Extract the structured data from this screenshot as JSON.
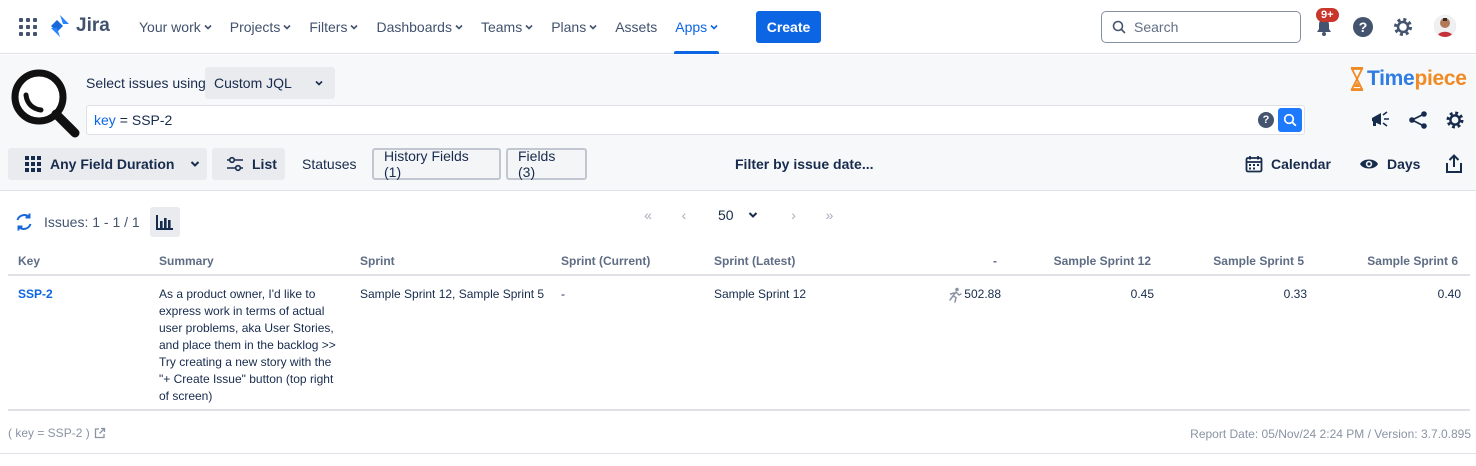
{
  "nav": {
    "logo": "Jira",
    "items": [
      {
        "label": "Your work",
        "caret": true,
        "active": false
      },
      {
        "label": "Projects",
        "caret": true,
        "active": false
      },
      {
        "label": "Filters",
        "caret": true,
        "active": false
      },
      {
        "label": "Dashboards",
        "caret": true,
        "active": false
      },
      {
        "label": "Teams",
        "caret": true,
        "active": false
      },
      {
        "label": "Plans",
        "caret": true,
        "active": false
      },
      {
        "label": "Assets",
        "caret": false,
        "active": false
      },
      {
        "label": "Apps",
        "caret": true,
        "active": true
      }
    ],
    "create_label": "Create",
    "search_placeholder": "Search",
    "notifications_badge": "9+"
  },
  "query": {
    "select_label": "Select issues using",
    "mode": "Custom JQL",
    "jql_keyword": "key",
    "jql_rest": "= SSP-2",
    "brand_left": "Time",
    "brand_right": "piece"
  },
  "toolbar": {
    "report_type": "Any Field Duration",
    "list_label": "List",
    "statuses_label": "Statuses",
    "history_fields_label": "History Fields (1)",
    "fields_label": "Fields (3)",
    "filter_date_label": "Filter by issue date...",
    "calendar_label": "Calendar",
    "days_label": "Days"
  },
  "results": {
    "count_label": "Issues: 1 - 1 / 1",
    "page_size": "50",
    "columns": [
      "Key",
      "Summary",
      "Sprint",
      "Sprint (Current)",
      "Sprint (Latest)",
      "-",
      "Sample Sprint 12",
      "Sample Sprint 5",
      "Sample Sprint 6"
    ],
    "rows": [
      {
        "key": "SSP-2",
        "summary_lines": [
          "As a product owner, I'd like to",
          "express work in terms of actual",
          "user problems, aka User Stories,",
          "and place them in the backlog >>",
          "Try creating a new story with the",
          "\"+ Create Issue\" button (top right",
          "of screen)"
        ],
        "sprint": "Sample Sprint 12, Sample Sprint 5",
        "sprint_current": "-",
        "sprint_latest": "Sample Sprint 12",
        "total": "502.88",
        "s12": "0.45",
        "s5": "0.33",
        "s6": "0.40"
      }
    ]
  },
  "footer": {
    "jql_label": "( key = SSP-2 )",
    "report_info": "Report Date: 05/Nov/24 2:24 PM / Version: 3.7.0.895"
  }
}
